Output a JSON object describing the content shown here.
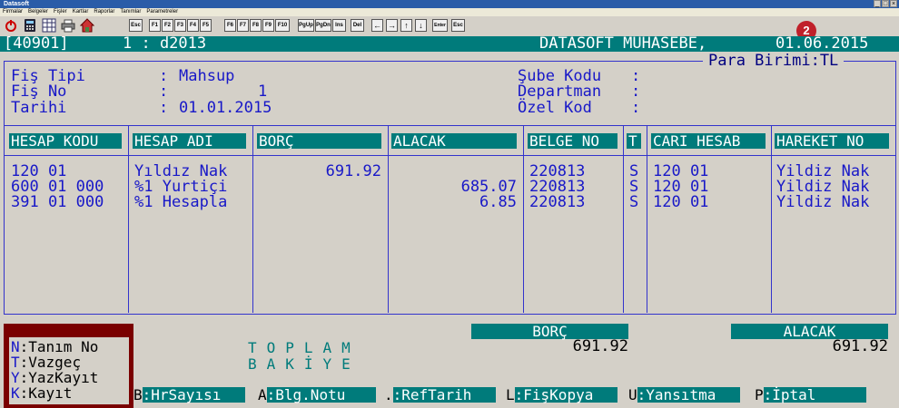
{
  "window": {
    "title": "Datasoft"
  },
  "menu": [
    "Firmalar",
    "Belgeler",
    "Fişler",
    "Kartlar",
    "Raporlar",
    "Tanımlar",
    "Parametreler"
  ],
  "toolbar": {
    "keys": [
      "Esc",
      "F1",
      "F2",
      "F3",
      "F4",
      "F5",
      "F6",
      "F7",
      "F8",
      "F9",
      "F10",
      "PgUp",
      "PgDn",
      "Ins",
      "Del",
      "←",
      "→",
      "↑",
      "↓",
      "Enter",
      "Esc"
    ],
    "icons": [
      "power-icon",
      "calculator-icon",
      "grid-icon",
      "printer-icon",
      "home-icon"
    ]
  },
  "badge": "2",
  "status": {
    "code": "[40901]",
    "session": "1 : d2013",
    "company": "DATASOFT MUHASEBE,",
    "date": "01.06.2015"
  },
  "para_birimi": "Para Birimi:TL",
  "form": {
    "fis_tipi_label": "Fiş Tipi",
    "fis_tipi_value": "Mahsup",
    "fis_no_label": "Fiş No",
    "fis_no_value": "1",
    "tarih_label": "Tarihi",
    "tarih_value": "01.01.2015",
    "colon": ":",
    "sube_label": "Şube Kodu",
    "departman_label": "Departman",
    "ozel_label": "Özel Kod"
  },
  "table": {
    "headers": [
      "HESAP KODU",
      "HESAP ADI",
      "BORÇ",
      "ALACAK",
      "BELGE NO",
      "T",
      "CARI HESAB",
      "HAREKET NO"
    ],
    "rows": [
      {
        "hesap_kodu": "120 01",
        "hesap_adi": "Yıldız Nak",
        "borc": "691.92",
        "alacak": "",
        "belge_no": "220813",
        "t": "S",
        "cari": "120 01",
        "hareket": "Yildiz Nak"
      },
      {
        "hesap_kodu": "600 01 000",
        "hesap_adi": "%1 Yurtiçi",
        "borc": "",
        "alacak": "685.07",
        "belge_no": "220813",
        "t": "S",
        "cari": "120 01",
        "hareket": "Yildiz Nak"
      },
      {
        "hesap_kodu": "391 01 000",
        "hesap_adi": "%1 Hesapla",
        "borc": "",
        "alacak": "6.85",
        "belge_no": "220813",
        "t": "S",
        "cari": "120 01",
        "hareket": "Yildiz Nak"
      }
    ]
  },
  "totals": {
    "borc_label": "BORÇ",
    "alacak_label": "ALACAK",
    "borc": "691.92",
    "alacak": "691.92",
    "toplam": "TOPLAM",
    "bakiye": "BAKİYE"
  },
  "shortcuts": [
    {
      "key": "N",
      "label": ":Tanım No"
    },
    {
      "key": "T",
      "label": ":Vazgeç"
    },
    {
      "key": "Y",
      "label": ":YazKayıt"
    },
    {
      "key": "K",
      "label": ":Kayıt"
    }
  ],
  "fkeys": [
    {
      "key": "B",
      "label": ":HrSayısı"
    },
    {
      "key": "A",
      "label": ":Blg.Notu"
    },
    {
      "key": ".",
      "label": ":RefTarih"
    },
    {
      "key": "L",
      "label": ":FişKopya"
    },
    {
      "key": "U",
      "label": ":Yansıtma"
    },
    {
      "key": "P",
      "label": ":İptal"
    }
  ]
}
